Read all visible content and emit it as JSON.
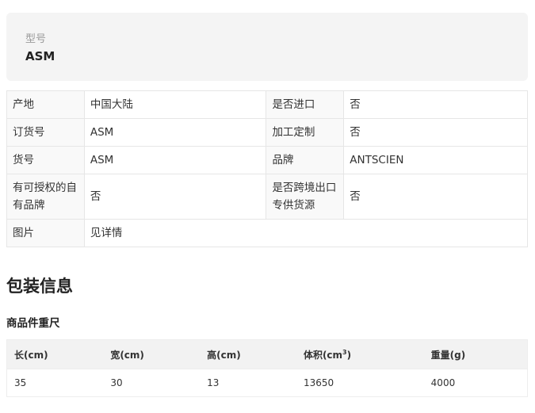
{
  "model": {
    "label": "型号",
    "value": "ASM"
  },
  "attributes": [
    {
      "k1": "产地",
      "v1": "中国大陆",
      "k2": "是否进口",
      "v2": "否"
    },
    {
      "k1": "订货号",
      "v1": "ASM",
      "k2": "加工定制",
      "v2": "否"
    },
    {
      "k1": "货号",
      "v1": "ASM",
      "k2": "品牌",
      "v2": "ANTSCIEN"
    },
    {
      "k1": "有可授权的自有品牌",
      "v1": "否",
      "k2": "是否跨境出口专供货源",
      "v2": "否"
    },
    {
      "k1": "图片",
      "v1": "见详情"
    }
  ],
  "packaging": {
    "title": "包装信息",
    "subtitle": "商品件重尺",
    "headers": [
      "长(cm)",
      "宽(cm)",
      "高(cm)",
      "体积(cm",
      "重量(g)"
    ],
    "volume_sup": "3",
    "volume_close": ")",
    "row": [
      "35",
      "30",
      "13",
      "13650",
      "4000"
    ]
  }
}
